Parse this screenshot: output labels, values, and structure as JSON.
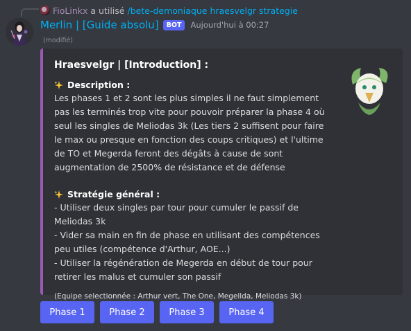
{
  "reply": {
    "user": "FioLinkx",
    "action": "a utilisé",
    "command": "/bete-demoniaque hraesvelgr strategie"
  },
  "message": {
    "username": "Merlin | [Guide absolu]",
    "bot_tag": "BOT",
    "timestamp": "Aujourd'hui à 00:27",
    "edited": "(modifié)"
  },
  "embed": {
    "accent_color": "#9b59b6",
    "title": "Hraesvelgr | [Introduction] :",
    "fields": [
      {
        "name": "Description :",
        "icon": "sparkles-icon",
        "value": "Les phases 1 et 2 sont les plus simples il ne faut simplement pas les terminés trop vite pour pouvoir préparer la phase 4 où seul les singles de Meliodas 3k (Les tiers 2 suffisent pour faire le max ou presque en fonction des coups critiques) et l'ultime de TO et Megerda feront des dégâts à cause de sont augmentation de 2500% de résistance et de défense"
      },
      {
        "name": "Stratégie général :",
        "icon": "sparkles-icon",
        "value": "- Utiliser deux singles par tour pour cumuler le passif de Meliodas 3k\n- Vider sa main en fin de phase en utilisant des compétences peu utiles (compétence d'Arthur, AOE...)\n- Utiliser la régénération de Megerda en début de tour pour retirer les malus et cumuler son passif"
      }
    ],
    "note": "(Equipe selectionnée : Arthur vert, The One, Megellda, Meliodas 3k)"
  },
  "buttons": [
    "Phase 1",
    "Phase 2",
    "Phase 3",
    "Phase 4"
  ]
}
